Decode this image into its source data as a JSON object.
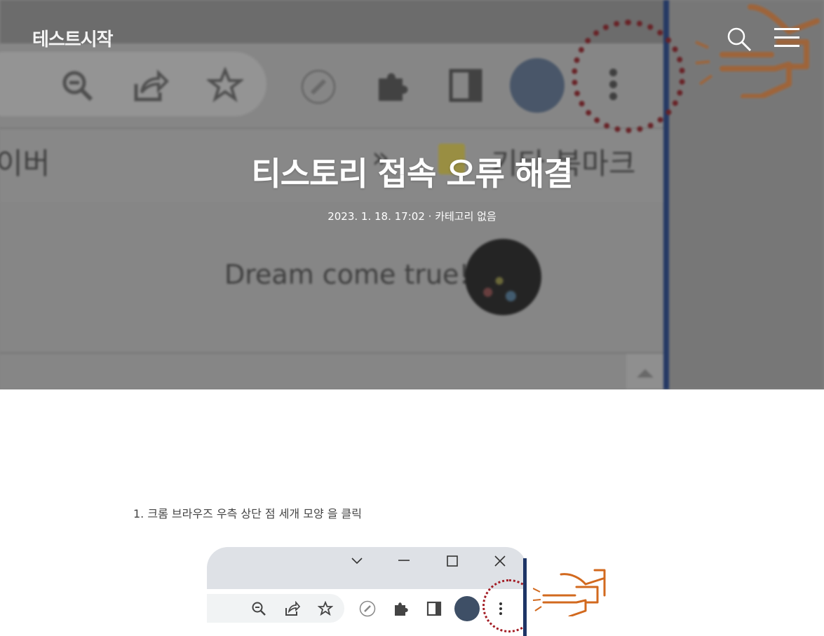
{
  "header": {
    "site_title": "테스트시작",
    "search_icon": "search-icon",
    "menu_icon": "hamburger-menu-icon"
  },
  "hero": {
    "post_title": "티스토리 접속 오류 해결",
    "date": "2023. 1. 18. 17:02",
    "separator": "·",
    "category": "카테고리 없음",
    "background_text": {
      "bookmark_left": "이버",
      "bookmark_right": "기타 북마크",
      "chevron": "»",
      "profile_text": "Dream come true!"
    }
  },
  "content": {
    "step1": "1. 크롬 브라우즈 우측 상단 점 세개 모양 을 클릭"
  },
  "screenshot": {
    "window_controls": [
      "chevron-down-icon",
      "minimize-icon",
      "maximize-icon",
      "close-icon"
    ],
    "toolbar_icons": [
      "zoom-out-icon",
      "share-icon",
      "star-icon",
      "pen-icon",
      "puzzle-icon",
      "side-panel-icon",
      "profile-avatar",
      "more-vert-icon"
    ]
  },
  "colors": {
    "highlight_circle": "#a31c24",
    "hand_pointer": "#d2691e",
    "hero_overlay": "#8a8a8a"
  }
}
